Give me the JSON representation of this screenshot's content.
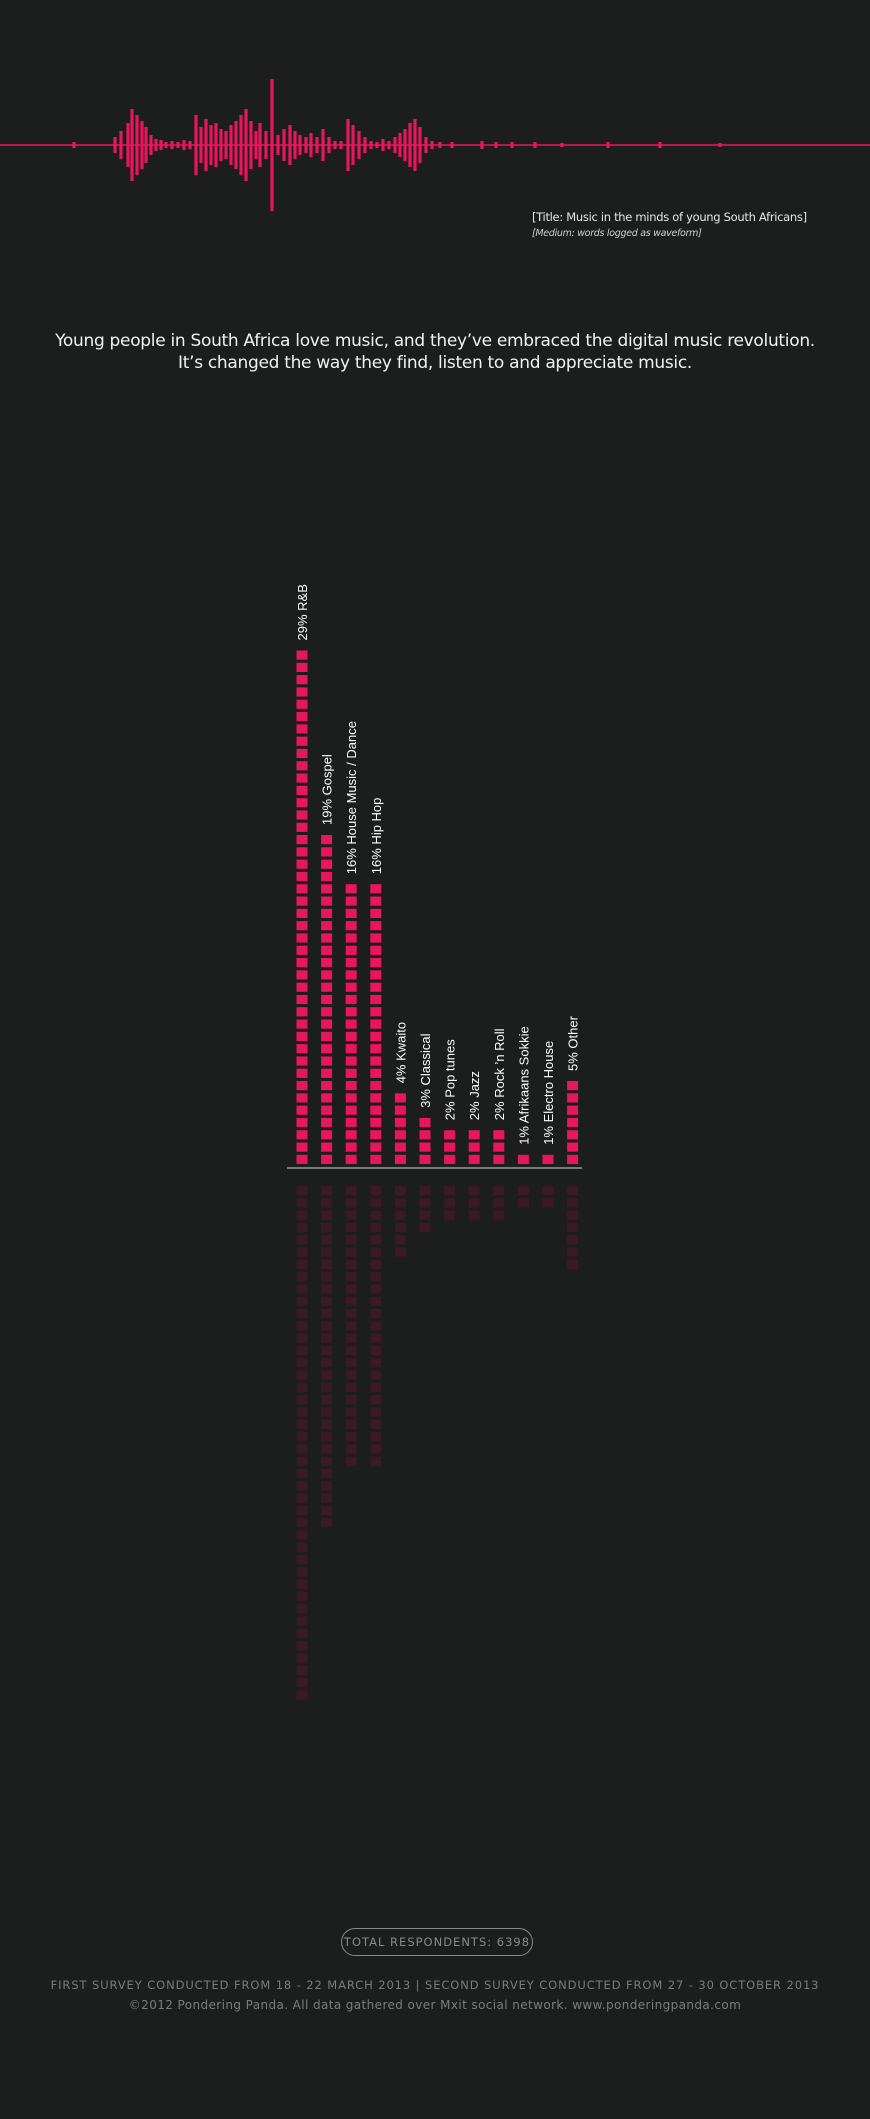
{
  "header": {
    "title_note": "[Title: Music in the minds of young South Africans]",
    "medium_note": "[Medium: words logged as waveform]"
  },
  "intro": {
    "line1": "Young people in South Africa love music, and they’ve embraced the digital music revolution.",
    "line2": "It’s changed the way they find, listen to and appreciate music."
  },
  "colors": {
    "background": "#1c1d1d",
    "accent": "#e8175d",
    "reflection": "#3b1a26"
  },
  "chart_data": {
    "type": "bar",
    "title": "",
    "xlabel": "",
    "ylabel": "",
    "categories": [
      "R&B",
      "Gospel",
      "House Music / Dance",
      "Hip Hop",
      "Kwaito",
      "Classical",
      "Pop tunes",
      "Jazz",
      "Rock ’n Roll",
      "Afrikaans Sokkie",
      "Electro House",
      "Other"
    ],
    "labels": [
      "29% R&B",
      "19% Gospel",
      "16% House Music / Dance",
      "16% Hip Hop",
      "4% Kwaito",
      "3% Classical",
      "2% Pop tunes",
      "2% Jazz",
      "2% Rock ’n Roll",
      "1% Afrikaans Sokkie",
      "1% Electro House",
      "5% Other"
    ],
    "values": [
      29,
      19,
      16,
      16,
      4,
      3,
      2,
      2,
      2,
      1,
      1,
      5
    ],
    "unit": "%",
    "grid": false,
    "legend": "none"
  },
  "footer": {
    "respondents": "TOTAL RESPONDENTS: 6398",
    "surveys": "FIRST SURVEY CONDUCTED FROM 18 - 22 MARCH 2013  |  SECOND SURVEY CONDUCTED FROM 27 - 30 OCTOBER 2013",
    "credit": "©2012 Pondering Panda. All data gathered over Mxit social network. www.ponderingpanda.com"
  }
}
